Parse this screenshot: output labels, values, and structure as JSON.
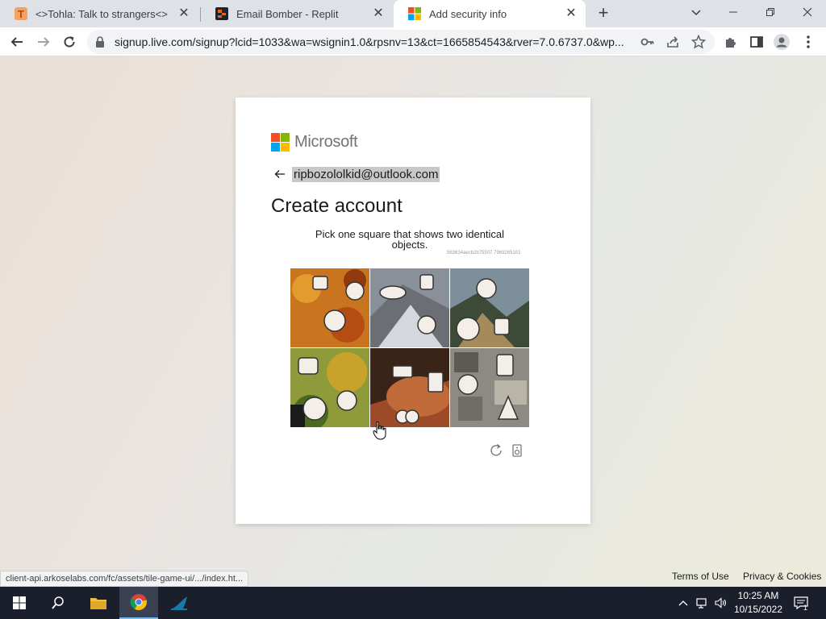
{
  "browser": {
    "tabs": [
      {
        "title": "<>Tohla: Talk to strangers<>",
        "icon": "tohla-favicon"
      },
      {
        "title": "Email Bomber - Replit",
        "icon": "replit-favicon"
      },
      {
        "title": "Add security info",
        "icon": "microsoft-favicon"
      }
    ],
    "url_text": "signup.live.com/signup?lcid=1033&wa=wsignin1.0&rpsnv=13&ct=1665854543&rver=7.0.6737.0&wp...",
    "status_url": "client-api.arkoselabs.com/fc/assets/tile-game-ui/.../index.ht..."
  },
  "signup": {
    "brand": "Microsoft",
    "email": "ripbozololkid@outlook.com",
    "heading": "Create account",
    "captcha_prompt": "Pick one square that shows two identical objects.",
    "captcha_session": "563634aecb2b75507.7969265101",
    "tiles": [
      {
        "id": "tile-1",
        "bg": "#c9741f",
        "fg": "#b54d12"
      },
      {
        "id": "tile-2",
        "bg": "#8a9099",
        "fg": "#d4d8dc"
      },
      {
        "id": "tile-3",
        "bg": "#7d8f9a",
        "fg": "#3d4a38"
      },
      {
        "id": "tile-4",
        "bg": "#8f9a3a",
        "fg": "#c9a22c"
      },
      {
        "id": "tile-5",
        "bg": "#9c4a28",
        "fg": "#3a2418"
      },
      {
        "id": "tile-6",
        "bg": "#8c8a82",
        "fg": "#5c5a54"
      }
    ],
    "selected_tile": 5
  },
  "footer": {
    "terms": "Terms of Use",
    "privacy": "Privacy & Cookies"
  },
  "taskbar": {
    "time": "10:25 AM",
    "date": "10/15/2022",
    "notification_count": "1"
  },
  "colors": {
    "ms_red": "#f25022",
    "ms_green": "#7fba00",
    "ms_blue": "#00a4ef",
    "ms_yellow": "#ffb900"
  }
}
